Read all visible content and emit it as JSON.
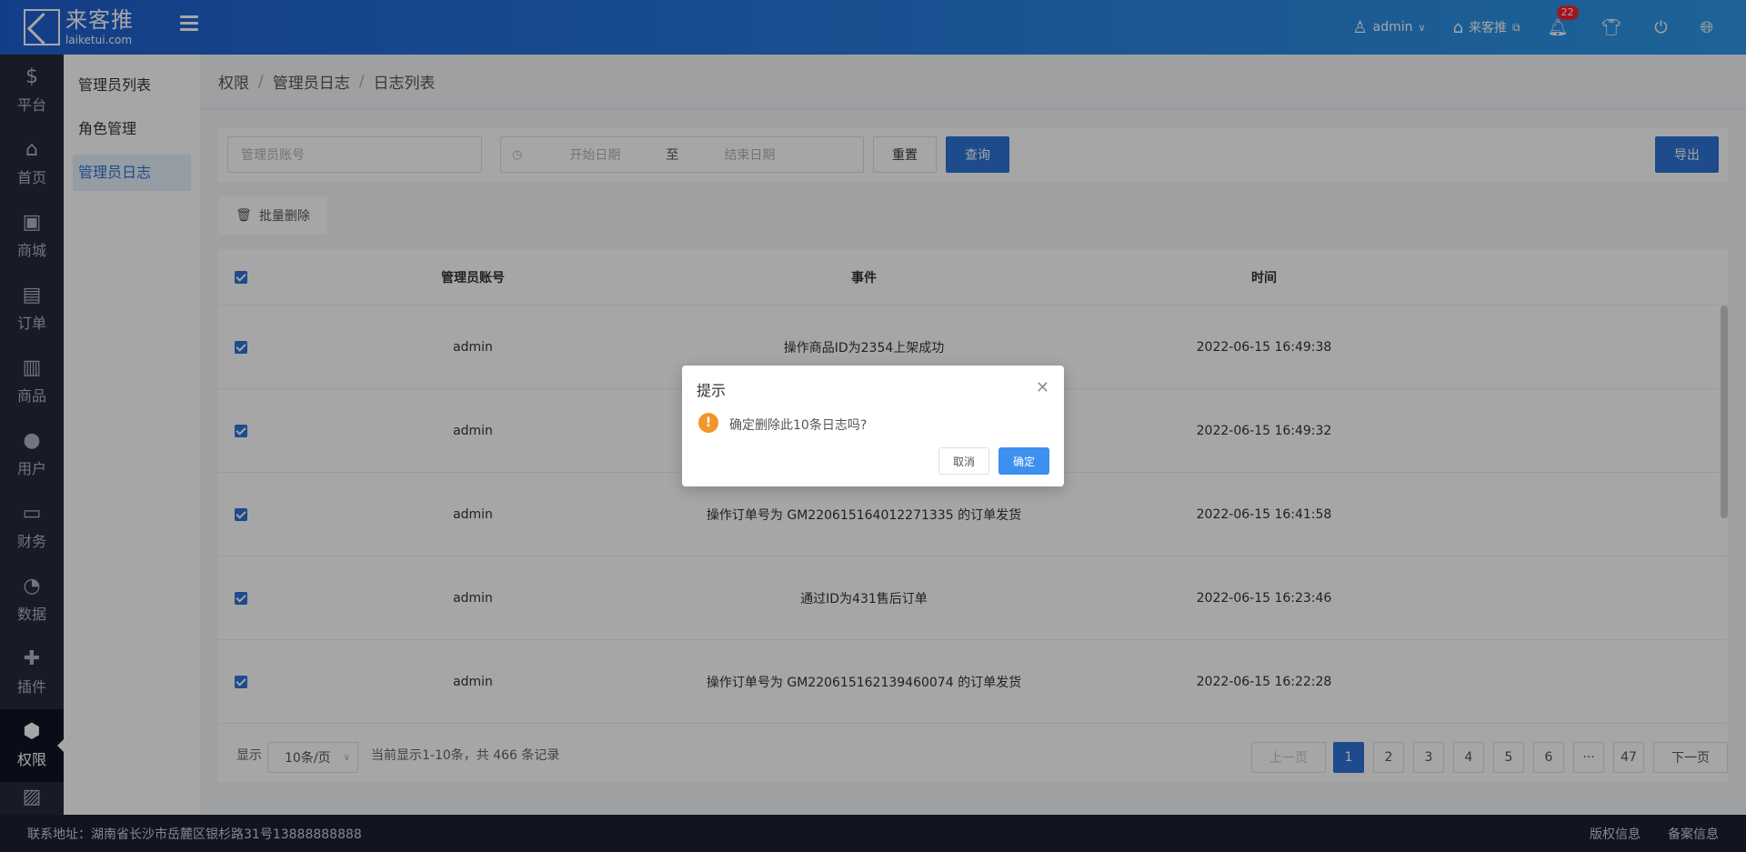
{
  "brand": {
    "name_cn": "来客推",
    "name_en": "laiketui.com"
  },
  "header": {
    "user": "admin",
    "store": "来客推",
    "notifications": "22"
  },
  "side_nav": [
    {
      "label": "平台",
      "icon": "$"
    },
    {
      "label": "首页",
      "icon": "⌂"
    },
    {
      "label": "商城",
      "icon": "▣"
    },
    {
      "label": "订单",
      "icon": "▤"
    },
    {
      "label": "商品",
      "icon": "▥"
    },
    {
      "label": "用户",
      "icon": "●"
    },
    {
      "label": "财务",
      "icon": "▭"
    },
    {
      "label": "数据",
      "icon": "◔"
    },
    {
      "label": "插件",
      "icon": "✚"
    },
    {
      "label": "权限",
      "icon": "⬢"
    }
  ],
  "sub_nav": [
    "管理员列表",
    "角色管理",
    "管理员日志"
  ],
  "breadcrumb": [
    "权限",
    "管理员日志",
    "日志列表"
  ],
  "filters": {
    "account_placeholder": "管理员账号",
    "start_placeholder": "开始日期",
    "range_sep": "至",
    "end_placeholder": "结束日期",
    "reset": "重置",
    "query": "查询",
    "export": "导出"
  },
  "batch_delete": "批量删除",
  "table": {
    "headers": [
      "管理员账号",
      "事件",
      "时间"
    ],
    "rows": [
      {
        "account": "admin",
        "event": "操作商品ID为2354上架成功",
        "time": "2022-06-15 16:49:38"
      },
      {
        "account": "admin",
        "event": "",
        "time": "2022-06-15 16:49:32"
      },
      {
        "account": "admin",
        "event": "操作订单号为 GM220615164012271335 的订单发货",
        "time": "2022-06-15 16:41:58"
      },
      {
        "account": "admin",
        "event": "通过ID为431售后订单",
        "time": "2022-06-15 16:23:46"
      },
      {
        "account": "admin",
        "event": "操作订单号为 GM220615162139460074 的订单发货",
        "time": "2022-06-15 16:22:28"
      }
    ]
  },
  "pager": {
    "show": "显示",
    "page_size": "10条/页",
    "summary": "当前显示1-10条，共 466 条记录",
    "prev": "上一页",
    "pages": [
      "1",
      "2",
      "3",
      "4",
      "5",
      "6",
      "···",
      "47"
    ],
    "next": "下一页"
  },
  "footer": {
    "address": "联系地址：湖南省长沙市岳麓区银杉路31号13888888888",
    "copyright": "版权信息",
    "record": "备案信息"
  },
  "dialog": {
    "title": "提示",
    "message": "确定删除此10条日志吗?",
    "cancel": "取消",
    "confirm": "确定"
  }
}
